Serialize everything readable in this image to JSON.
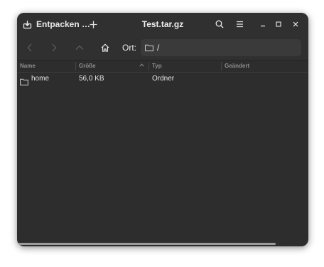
{
  "header": {
    "extract_label": "Entpacken …",
    "title": "Test.tar.gz"
  },
  "toolbar": {
    "location_label": "Ort:",
    "location_path": "/"
  },
  "columns": [
    "Name",
    "Größe",
    "Typ",
    "Geändert"
  ],
  "rows": [
    {
      "name": "home",
      "size": "56,0 KB",
      "type": "Ordner",
      "modified": ""
    }
  ]
}
